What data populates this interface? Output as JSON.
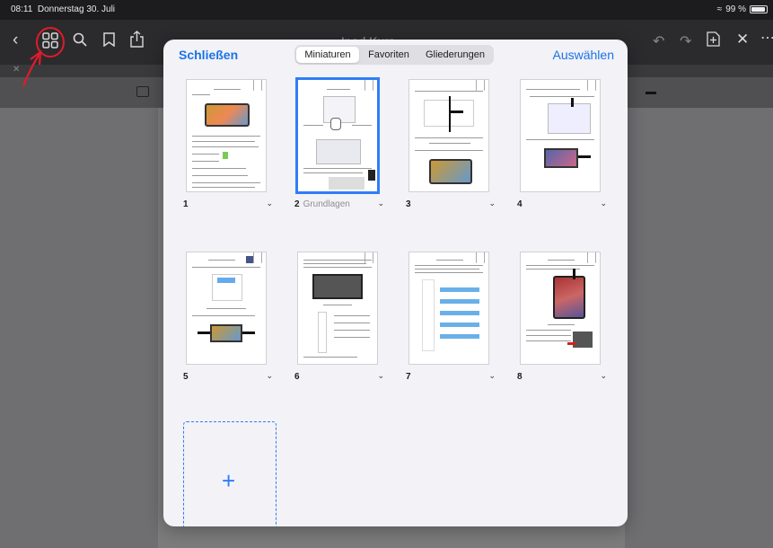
{
  "status_bar": {
    "time": "08:11",
    "date": "Donnerstag 30. Juli",
    "battery": "99 %"
  },
  "app": {
    "title": "Ipad Kurs"
  },
  "modal": {
    "close_label": "Schließen",
    "select_label": "Auswählen",
    "tabs": [
      {
        "label": "Miniaturen",
        "active": true
      },
      {
        "label": "Favoriten",
        "active": false
      },
      {
        "label": "Gliederungen",
        "active": false
      }
    ],
    "pages": [
      {
        "number": "1",
        "name": ""
      },
      {
        "number": "2",
        "name": "Grundlagen",
        "selected": true
      },
      {
        "number": "3",
        "name": ""
      },
      {
        "number": "4",
        "name": ""
      },
      {
        "number": "5",
        "name": ""
      },
      {
        "number": "6",
        "name": ""
      },
      {
        "number": "7",
        "name": ""
      },
      {
        "number": "8",
        "name": ""
      }
    ],
    "add_page_label": "+"
  },
  "colors": {
    "accent": "#1a73e8",
    "annotation": "#e01b2a"
  },
  "icons": [
    "back-icon",
    "grid-view-icon",
    "search-icon",
    "bookmark-icon",
    "share-icon",
    "undo-icon",
    "redo-icon",
    "add-page-icon",
    "close-icon",
    "more-icon",
    "wifi-icon",
    "battery-icon"
  ]
}
